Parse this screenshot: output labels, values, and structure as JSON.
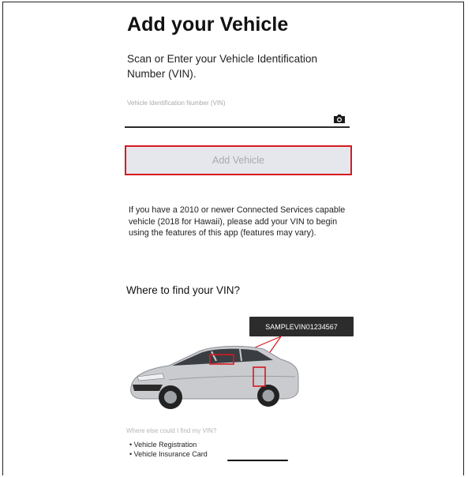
{
  "page": {
    "title": "Add your Vehicle",
    "subtitle": "Scan or Enter your Vehicle Identification Number (VIN).",
    "vin_field": {
      "label": "Vehicle Identification Number (VIN)",
      "value": ""
    },
    "camera_icon": "camera-icon",
    "add_button_label": "Add Vehicle",
    "info_text": "If you have a 2010 or newer Connected Services capable vehicle (2018 for Hawaii), please add your VIN to begin using the features of this app (features may vary).",
    "where_heading": "Where to find your VIN?",
    "sample_vin": "SAMPLEVIN01234567",
    "else_label": "Where else could I find my VIN?",
    "locations": [
      "Vehicle Registration",
      "Vehicle Insurance Card"
    ]
  },
  "colors": {
    "highlight_red": "#d71920",
    "button_bg": "#e6e7ec",
    "button_text": "#a8a8ae",
    "callout_bg": "#2c2c2c",
    "car_body": "#c9cbcf"
  }
}
